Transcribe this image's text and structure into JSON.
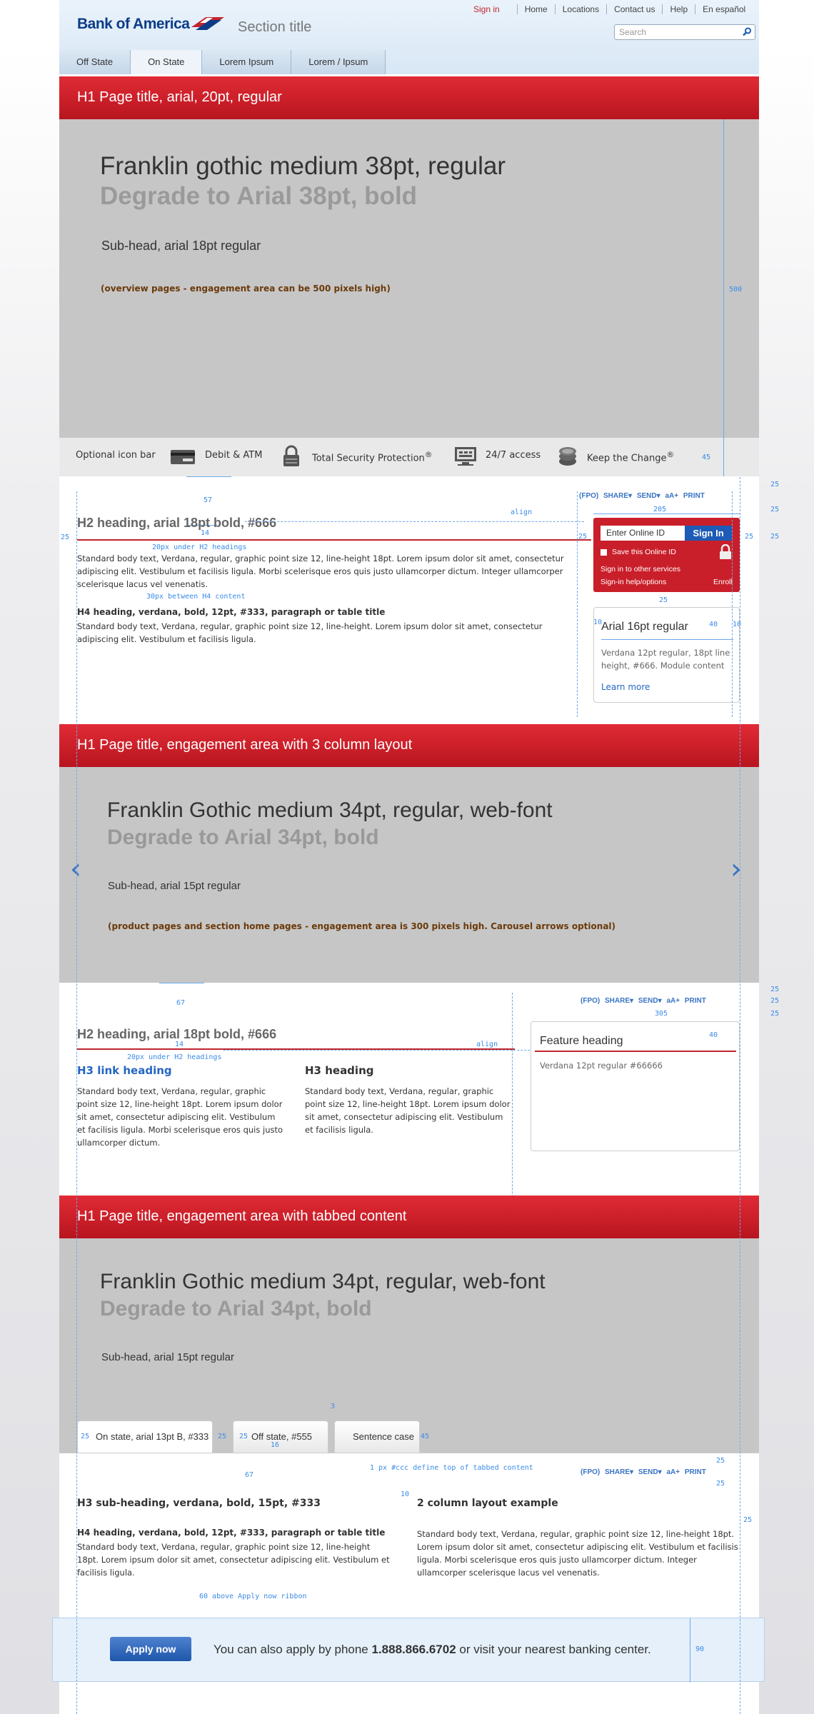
{
  "header": {
    "logo": "Bank of America",
    "section_title": "Section title",
    "util": [
      "Sign in",
      "Home",
      "Locations",
      "Contact us",
      "Help",
      "En español"
    ],
    "search_placeholder": "Search",
    "nav": [
      "Off State",
      "On State",
      "Lorem Ipsum",
      "Lorem / Ipsum"
    ]
  },
  "section1": {
    "red_title": "H1 Page title, arial, 20pt, regular",
    "hero_line1": "Franklin gothic medium 38pt, regular",
    "hero_line2": "Degrade to Arial 38pt, bold",
    "subhead": "Sub-head, arial 18pt regular",
    "note": "(overview pages - engagement area can be 500 pixels high)",
    "height_ann": "500",
    "iconbar": {
      "label": "Optional icon bar",
      "items": [
        "Debit & ATM",
        "Total Security Protection",
        "24/7 access",
        "Keep the Change"
      ],
      "reg": "®",
      "ann": "45"
    },
    "ann": {
      "a57": "57",
      "a14": "14",
      "a25l": "25",
      "a25r": "25",
      "a25r2": "25",
      "a25r3": "25",
      "a25r4": "25",
      "align": "align",
      "under": "20px under H2 headings",
      "between": "30px between H4 content",
      "a205": "205",
      "a25m": "25",
      "a10l": "10",
      "a10r": "10",
      "a40": "40"
    },
    "h2": "H2 heading, arial 18pt bold, #666",
    "body1": "Standard body text, Verdana, regular, graphic point size 12, line-height 18pt. Lorem ipsum dolor sit amet, consectetur adipiscing elit. Vestibulum et facilisis ligula. Morbi scelerisque eros quis justo ullamcorper dictum. Integer ullamcorper scelerisque lacus vel venenatis.",
    "h4": "H4 heading, verdana, bold, 12pt, #333, paragraph or table title",
    "body2": "Standard body text, Verdana, regular, graphic point size 12, line-height. Lorem ipsum dolor sit amet, consectetur adipiscing elit. Vestibulum et facilisis ligula.",
    "share": {
      "fpo": "(FPO)",
      "share": "SHARE",
      "send": "SEND",
      "aa": "aA+",
      "print": "PRINT"
    },
    "signin": {
      "placeholder": "Enter Online ID",
      "button": "Sign In",
      "save": "Save this Online ID",
      "other": "Sign in to other services",
      "help": "Sign-in help/options",
      "enroll": "Enroll"
    },
    "module": {
      "heading": "Arial 16pt regular",
      "body": "Verdana 12pt regular, 18pt line height, #666. Module content",
      "link": "Learn more"
    }
  },
  "section2": {
    "red_title": "H1 Page title, engagement area with 3 column layout",
    "hero_line1": "Franklin Gothic medium 34pt, regular, web-font",
    "hero_line2": "Degrade to Arial 34pt, bold",
    "subhead": "Sub-head, arial 15pt regular",
    "note": "(product pages and section home pages - engagement area is 300 pixels high. Carousel arrows optional)",
    "arrow_left": "‹",
    "arrow_right": "›",
    "ann": {
      "a67": "67",
      "a14": "14",
      "under": "20px under H2 headings",
      "align": "align",
      "a305": "305",
      "a40": "40",
      "a25a": "25",
      "a25b": "25",
      "a25c": "25"
    },
    "h2": "H2 heading, arial 18pt bold, #666",
    "col1_h3": "H3 link heading",
    "col1_body": "Standard body text, Verdana, regular, graphic point size 12, line-height 18pt. Lorem ipsum dolor sit amet, consectetur adipiscing elit. Vestibulum et facilisis ligula. Morbi scelerisque eros quis justo ullamcorper dictum.",
    "col2_h3": "H3 heading",
    "col2_body": "Standard body text, Verdana, regular, graphic point size 12, line-height 18pt. Lorem ipsum dolor sit amet, consectetur adipiscing elit. Vestibulum et facilisis ligula.",
    "feature_heading": "Feature heading",
    "feature_body": "Verdana 12pt regular #66666"
  },
  "section3": {
    "red_title": "H1 Page title, engagement area with tabbed content",
    "hero_line1": "Franklin Gothic medium 34pt, regular, web-font",
    "hero_line2": "Degrade to Arial 34pt, bold",
    "subhead": "Sub-head, arial 15pt regular",
    "tabs": [
      "On state, arial 13pt B, #333",
      "Off state, #555",
      "Sentence case"
    ],
    "ann": {
      "t25a": "25",
      "t25b": "25",
      "t25c": "25",
      "t45": "45",
      "t3": "3",
      "t16": "16",
      "t67": "67",
      "ccc": "1 px #ccc define top of tabbed content",
      "s25a": "25",
      "s25b": "25",
      "s25c": "25",
      "s10": "10",
      "above": "60 above Apply now ribbon",
      "r90": "90"
    },
    "h3": "H3 sub-heading, verdana, bold, 15pt, #333",
    "h4": "H4 heading, verdana, bold, 12pt, #333, paragraph or table title",
    "body1": "Standard body text, Verdana, regular, graphic point size 12, line-height 18pt. Lorem ipsum dolor sit amet, consectetur adipiscing elit. Vestibulum et facilisis ligula.",
    "col2_h": "2 column layout example",
    "col2_body": "Standard body text, Verdana, regular, graphic point size 12, line-height 18pt. Lorem ipsum dolor sit amet, consectetur adipiscing elit. Vestibulum et facilisis ligula. Morbi scelerisque eros quis justo ullamcorper dictum. Integer ullamcorper scelerisque lacus vel venenatis."
  },
  "ribbon": {
    "button": "Apply now",
    "text_before": "You can also apply by phone ",
    "phone": "1.888.866.6702",
    "text_after": " or visit your nearest banking center."
  }
}
